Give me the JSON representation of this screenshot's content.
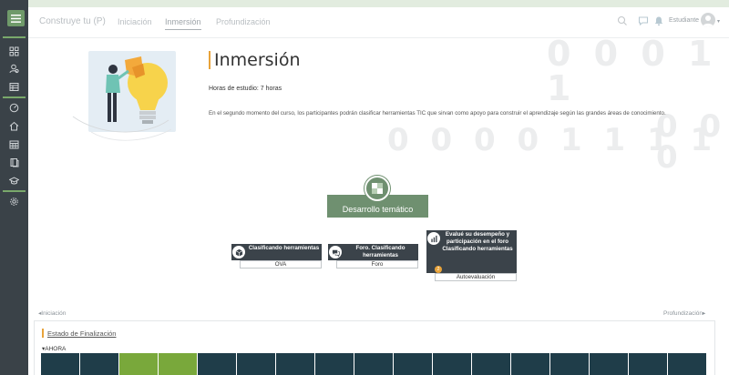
{
  "header": {
    "course_name": "Construye tu (P)",
    "tabs": [
      {
        "label": "Iniciación",
        "active": false
      },
      {
        "label": "Inmersión",
        "active": true
      },
      {
        "label": "Profundización",
        "active": false
      }
    ],
    "user_name": "Estudiante",
    "icons": [
      "search-icon",
      "chat-icon",
      "bell-icon"
    ]
  },
  "sidebar": {
    "menu_icon": "hamburger-icon",
    "items": [
      "dashboard-icon",
      "users-icon",
      "gradebook-icon",
      "speedometer-icon",
      "home-icon",
      "calendar-icon",
      "book-icon",
      "graduation-icon",
      "gear-icon"
    ]
  },
  "background_digits": {
    "row1": "0 0 0 1 1",
    "row2": "0 0 0 0 1 1 1 1",
    "row3": "0 0 0"
  },
  "main": {
    "title": "Inmersión",
    "hours": "Horas de estudio: 7 horas",
    "description": "En el segundo momento del curso, los participantes podrán clasificar herramientas TIC que sirvan como apoyo para construir el aprendizaje según las grandes áreas de conocimiento."
  },
  "center_node": {
    "label": "Desarrollo temático",
    "icon": "puzzle-icon"
  },
  "activities": [
    {
      "title": "Clasificando herramientas",
      "sub": "OVA",
      "icon": "cube-icon"
    },
    {
      "title": "Foro. Clasificando herramientas",
      "sub": "Foro",
      "icon": "chat-bubbles-icon"
    },
    {
      "title": "Evalué su desempeño y participación en el foro Clasificando herramientas",
      "sub": "Autoevaluación",
      "icon": "bar-chart-icon",
      "badge": "2"
    }
  ],
  "navigation": {
    "prev": "◂Iniciación",
    "next": "Profundización▸"
  },
  "completion": {
    "title": "Estado de Finalización",
    "now_label": "AHORA",
    "blocks": [
      "pending",
      "pending",
      "done",
      "done",
      "pending",
      "pending",
      "pending",
      "pending",
      "pending",
      "pending",
      "pending",
      "pending",
      "pending",
      "pending",
      "pending",
      "pending",
      "pending"
    ]
  },
  "colors": {
    "sidebar": "#3a4248",
    "accent_green": "#6f9070",
    "accent_orange": "#e8a33a",
    "card_dark": "#3b434a",
    "block_pending": "#1f3d49",
    "block_done": "#79a83b"
  }
}
